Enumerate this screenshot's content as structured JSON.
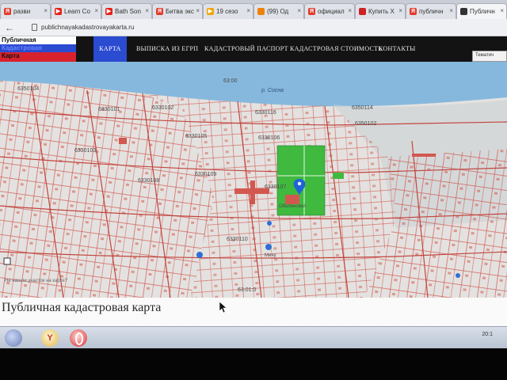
{
  "browser": {
    "tabs": [
      {
        "label": "разви",
        "icon": "yandex-icon",
        "color": "#e23b2e"
      },
      {
        "label": "Learn Co",
        "icon": "youtube-icon",
        "color": "#e62117"
      },
      {
        "label": "Bath Son",
        "icon": "youtube-icon",
        "color": "#e62117"
      },
      {
        "label": "Битва экс",
        "icon": "yandex-icon",
        "color": "#e23b2e"
      },
      {
        "label": "19 сезо",
        "icon": "play-icon",
        "color": "#f0a500"
      },
      {
        "label": "(99) Од",
        "icon": "ok-icon",
        "color": "#ee8208"
      },
      {
        "label": "официал",
        "icon": "yandex-icon",
        "color": "#e23b2e"
      },
      {
        "label": "Купить Х",
        "icon": "shop-icon",
        "color": "#cc2222"
      },
      {
        "label": "публичн",
        "icon": "yandex-icon",
        "color": "#e23b2e"
      },
      {
        "label": "Публичн",
        "icon": "map-icon",
        "color": "#333333",
        "active": true
      }
    ],
    "url": "publichnayakadastrovayakarta.ru"
  },
  "site": {
    "logo": {
      "line1": "Публичная",
      "line2": "Кадастровая",
      "line3": "Карта"
    },
    "nav": [
      {
        "label": "КАРТА",
        "active": true
      },
      {
        "label": "ВЫПИСКА ИЗ ЕГРП"
      },
      {
        "label": "КАДАСТРОВЫЙ ПАСПОРТ"
      },
      {
        "label": "КАДАСТРОВАЯ СТОИМОСТЬ"
      },
      {
        "label": "КОНТАКТЫ"
      }
    ],
    "tools_label": "Тематич"
  },
  "map": {
    "river_name": "р. Сосна",
    "water_id": "63:00",
    "quarters": [
      "6350104",
      "6330101",
      "6330102",
      "6330116",
      "6350114",
      "6350102",
      "6330105",
      "6330103",
      "6330106",
      "6330109",
      "6330108",
      "6330107",
      "6330110"
    ],
    "pin_label": "Оболенский",
    "bottom_note": "Не нашли участок на карте?",
    "road_label": "Мичу",
    "bottom_quarter": "63:01:0"
  },
  "page_title": "Публичная кадастровая карта",
  "taskbar": {
    "clock": "20:1"
  },
  "colors": {
    "nav_active": "#2b4bd1",
    "parcel_border": "#d2584f",
    "green_area": "#3fba3f",
    "water": "#86b8dd"
  }
}
